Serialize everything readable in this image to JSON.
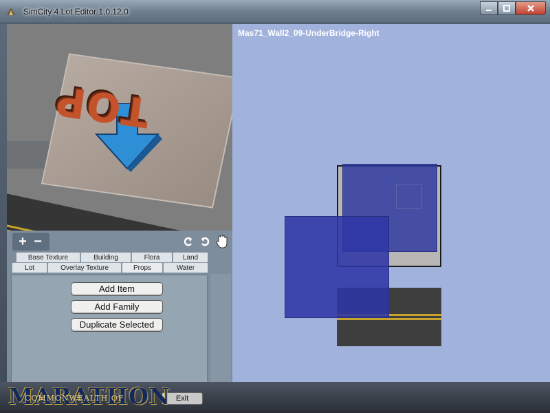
{
  "window": {
    "title": "SimCity 4 Lot Editor 1.0.12.0",
    "icon": "simcity-app-icon",
    "controls": [
      "minimize-icon",
      "maximize-icon",
      "close-icon"
    ]
  },
  "preview3d": {
    "model_text": "TOP"
  },
  "view2d": {
    "prop_name": "Mas71_Wall2_09-UnderBridge-Right",
    "zoom_in": "+",
    "zoom_out": "−"
  },
  "toolbar": {
    "zoom_in": "+",
    "zoom_out": "−",
    "rotate_left_icon": "rotate-ccw-icon",
    "rotate_right_icon": "rotate-cw-icon",
    "pan_icon": "hand-icon"
  },
  "tabs": {
    "row1": [
      "Base Texture",
      "Building",
      "Flora",
      "Land"
    ],
    "row2": [
      "Lot",
      "Overlay Texture",
      "Props",
      "Water"
    ],
    "active": "Props"
  },
  "actions": {
    "add_item": "Add Item",
    "add_family": "Add Family",
    "duplicate_selected": "Duplicate Selected",
    "exit": "Exit"
  },
  "watermark": {
    "main": "MARATHON",
    "sub": "COMMONWEALTH OF"
  }
}
